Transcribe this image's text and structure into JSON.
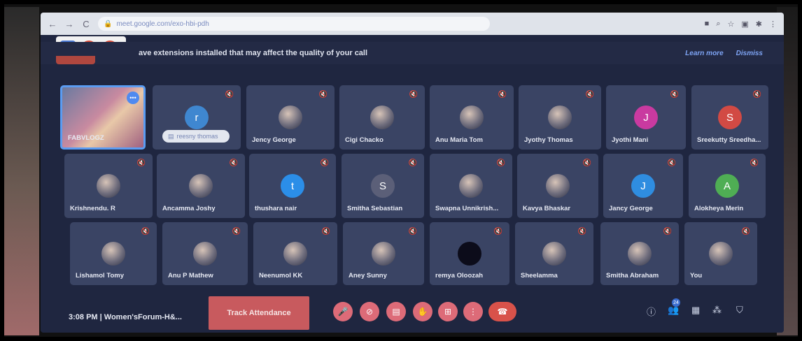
{
  "browser": {
    "url": "meet.google.com/exo-hbi-pdh",
    "back": "←",
    "forward": "→",
    "reload": "C"
  },
  "warning": {
    "text": "ave extensions installed that may affect the quality of your call",
    "learn_more": "Learn more",
    "dismiss": "Dismiss"
  },
  "participants": [
    {
      "name": "FABVLOGZ",
      "type": "self"
    },
    {
      "name": "reesny thomas",
      "type": "letter",
      "letter": "r",
      "color": "#3f87d0",
      "pill": true
    },
    {
      "name": "Jency George",
      "type": "photo"
    },
    {
      "name": "Cigi Chacko",
      "type": "photo"
    },
    {
      "name": "Anu Maria Tom",
      "type": "photo"
    },
    {
      "name": "Jyothy Thomas",
      "type": "photo"
    },
    {
      "name": "Jyothi Mani",
      "type": "letter",
      "letter": "J",
      "color": "#c93aa0"
    },
    {
      "name": "Sreekutty Sreedha...",
      "type": "letter",
      "letter": "S",
      "color": "#d24a44"
    },
    {
      "name": "Krishnendu. R",
      "type": "photo"
    },
    {
      "name": "Ancamma Joshy",
      "type": "photo"
    },
    {
      "name": "thushara nair",
      "type": "letter",
      "letter": "t",
      "color": "#2b8ee8"
    },
    {
      "name": "Smitha Sebastian",
      "type": "letter",
      "letter": "S",
      "color": "#5b5f78"
    },
    {
      "name": "Swapna Unnikrish...",
      "type": "photo"
    },
    {
      "name": "Kavya Bhaskar",
      "type": "photo"
    },
    {
      "name": "Jancy George",
      "type": "letter",
      "letter": "J",
      "color": "#2f8de0"
    },
    {
      "name": "Alokheya Merin",
      "type": "letter",
      "letter": "A",
      "color": "#4fae54"
    },
    {
      "name": "Lishamol Tomy",
      "type": "photo"
    },
    {
      "name": "Anu P Mathew",
      "type": "photo"
    },
    {
      "name": "Neenumol KK",
      "type": "photo"
    },
    {
      "name": "Aney Sunny",
      "type": "photo"
    },
    {
      "name": "remya Oloozah",
      "type": "dark"
    },
    {
      "name": "Sheelamma",
      "type": "photo"
    },
    {
      "name": "Smitha Abraham",
      "type": "photo"
    },
    {
      "name": "You",
      "type": "photo"
    }
  ],
  "bottom": {
    "time": "3:08 PM",
    "separator": "|",
    "meeting": "Women'sForum-H&...",
    "track_attendance": "Track Attendance",
    "people_count": "24"
  },
  "icons": {
    "mic": "🎤",
    "cam": "⊘",
    "captions": "▤",
    "hand": "✋",
    "present": "⊞",
    "more": "⋮",
    "hangup": "☎",
    "info": "ⓘ",
    "people": "👥",
    "chat": "▦",
    "activities": "⁂",
    "shield": "⛉"
  }
}
